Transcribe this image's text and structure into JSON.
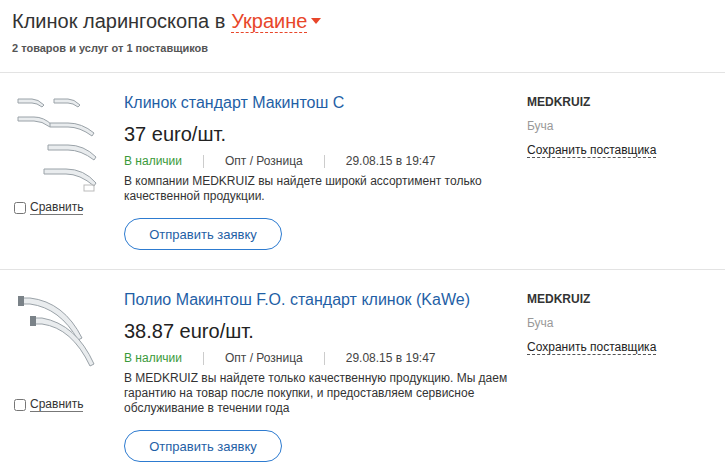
{
  "header": {
    "title": "Клинок ларингоскопа в",
    "region": "Украине",
    "subtitle": "2 товаров и услуг от 1 поставщиков"
  },
  "products": [
    {
      "kind": "macintosh-set",
      "title": "Клинок стандарт Макинтош С",
      "price": "37 euro/шт.",
      "availability": "В наличии",
      "trade": "Опт / Розница",
      "date": "29.08.15 в 19:47",
      "description": "В компании MEDKRUIZ вы найдете широкй ассортимент только качественной продукции.",
      "button": "Отправить заявку",
      "compare": {
        "label": "Сравнить",
        "checked": false
      },
      "supplier": {
        "name": "MEDKRUIZ",
        "city": "Буча",
        "save": "Сохранить поставщика"
      }
    },
    {
      "kind": "polio-pair",
      "title": "Полио Макинтош F.O. стандарт клинок (KaWe)",
      "price": "38.87 euro/шт.",
      "availability": "В наличии",
      "trade": "Опт / Розница",
      "date": "29.08.15 в 19:47",
      "description": "В MEDKRUIZ вы найдете только качественную продукцию. Мы даем гарантию на товар после покупки, и предоставляем сервисное обслуживание в течении года",
      "button": "Отправить заявку",
      "compare": {
        "label": "Сравнить",
        "checked": false
      },
      "supplier": {
        "name": "MEDKRUIZ",
        "city": "Буча",
        "save": "Сохранить поставщика"
      }
    }
  ]
}
